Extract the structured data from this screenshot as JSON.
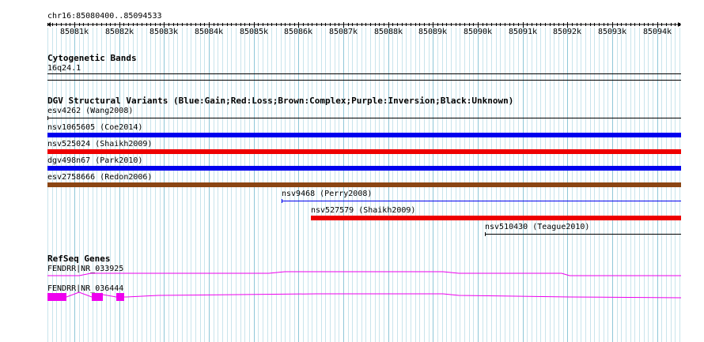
{
  "browser": {
    "region_label": "chr16:85080400..85094533",
    "ruler": {
      "start": 85080400,
      "end": 85094533,
      "ticks": [
        "85081k",
        "85082k",
        "85083k",
        "85084k",
        "85085k",
        "85086k",
        "85087k",
        "85088k",
        "85089k",
        "85090k",
        "85091k",
        "85092k",
        "85093k",
        "85094k"
      ]
    },
    "tracks": {
      "cytoband": {
        "title": "Cytogenetic Bands",
        "band": "16q24.1"
      },
      "dgv": {
        "title": "DGV Structural Variants (Blue:Gain;Red:Loss;Brown:Complex;Purple:Inversion;Black:Unknown)",
        "features": [
          {
            "label": "esv4262 (Wang2008)",
            "type": "Unknown",
            "color": "#000000",
            "start": 85080400,
            "end": 85094533,
            "thin": true
          },
          {
            "label": "nsv1065605 (Coe2014)",
            "type": "Gain",
            "color": "#0000ee",
            "start": 85080400,
            "end": 85094533
          },
          {
            "label": "nsv525024 (Shaikh2009)",
            "type": "Loss",
            "color": "#ee0000",
            "start": 85080400,
            "end": 85094533
          },
          {
            "label": "dgv498n67 (Park2010)",
            "type": "Gain",
            "color": "#0000ee",
            "start": 85080400,
            "end": 85094533
          },
          {
            "label": "esv2758666 (Redon2006)",
            "type": "Complex",
            "color": "#8b4513",
            "start": 85080400,
            "end": 85094533
          },
          {
            "label": "nsv9468 (Perry2008)",
            "type": "Gain",
            "color": "#0000ee",
            "start": 85085630,
            "end": 85094533,
            "thin": true
          },
          {
            "label": "nsv527579 (Shaikh2009)",
            "type": "Loss",
            "color": "#ee0000",
            "start": 85086270,
            "end": 85094533
          },
          {
            "label": "nsv510430 (Teague2010)",
            "type": "Unknown",
            "color": "#000000",
            "start": 85090150,
            "end": 85094533,
            "thin": true
          }
        ]
      },
      "refseq": {
        "title": "RefSeq Genes",
        "color": "#ee00ee",
        "genes": [
          {
            "label": "FENDRR|NR_033925"
          },
          {
            "label": "FENDRR|NR_036444"
          }
        ]
      }
    }
  }
}
